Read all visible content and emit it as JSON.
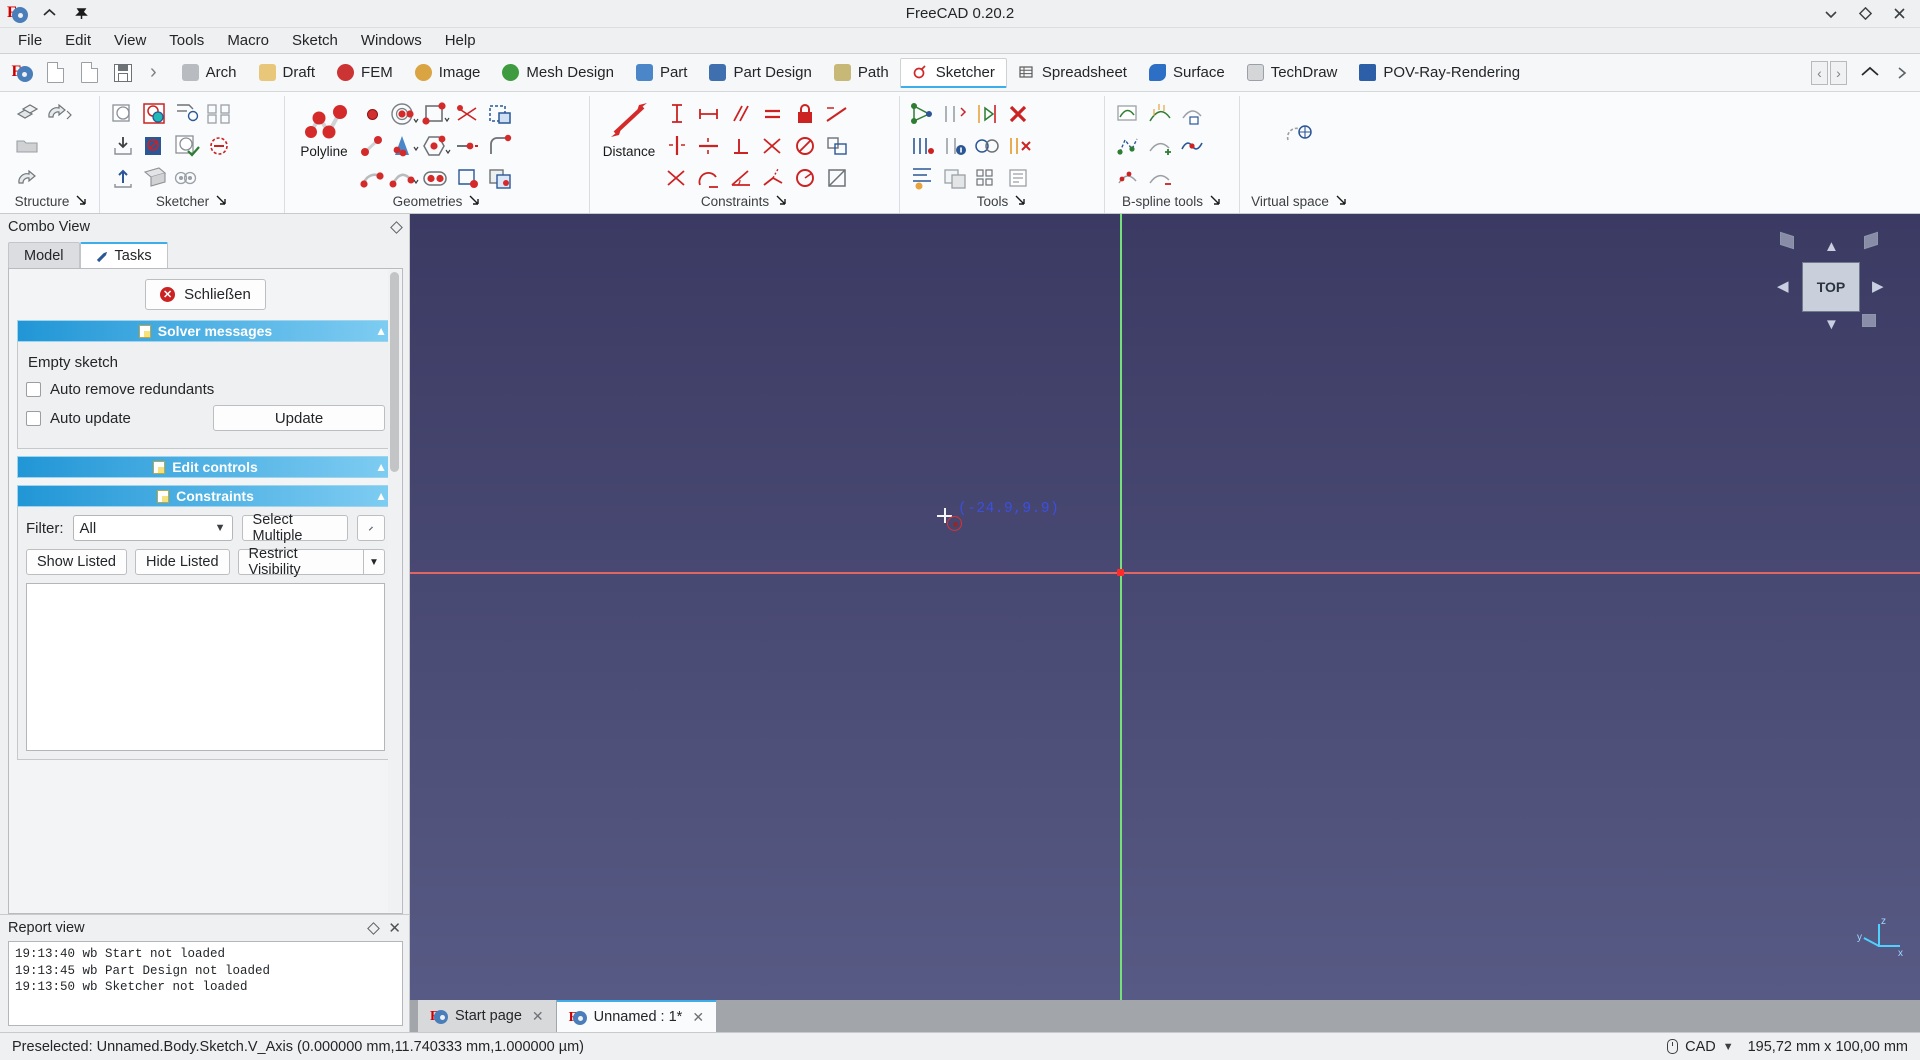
{
  "titlebar": {
    "title": "FreeCAD 0.20.2",
    "logo_icon": "freecad-logo-icon",
    "collapse_icon": "chevron-up-icon",
    "pin_icon": "pin-icon",
    "minimize_icon": "chevron-down-icon",
    "settings_icon": "diamond-icon",
    "close_icon": "close-icon"
  },
  "menubar": {
    "items": [
      {
        "label": "File"
      },
      {
        "label": "Edit"
      },
      {
        "label": "View"
      },
      {
        "label": "Tools"
      },
      {
        "label": "Macro"
      },
      {
        "label": "Sketch"
      },
      {
        "label": "Windows"
      },
      {
        "label": "Help"
      }
    ]
  },
  "workbench_tabs": {
    "quick_icons": [
      "freecad-logo-icon",
      "new-document-icon",
      "open-document-icon",
      "save-document-icon",
      "chevron-right-icon"
    ],
    "items": [
      {
        "label": "Arch",
        "icon": "arch-icon",
        "color": "#b8bcc0",
        "active": false
      },
      {
        "label": "Draft",
        "icon": "draft-icon",
        "color": "#e8c77a",
        "active": false
      },
      {
        "label": "FEM",
        "icon": "fem-icon",
        "color": "#cc3333",
        "active": false
      },
      {
        "label": "Image",
        "icon": "image-icon",
        "color": "#d9a441",
        "active": false
      },
      {
        "label": "Mesh Design",
        "icon": "mesh-design-icon",
        "color": "#3f9b3f",
        "active": false
      },
      {
        "label": "Part",
        "icon": "part-icon",
        "color": "#4a86c8",
        "active": false
      },
      {
        "label": "Part Design",
        "icon": "part-design-icon",
        "color": "#3f6fae",
        "active": false
      },
      {
        "label": "Path",
        "icon": "path-icon",
        "color": "#c8b878",
        "active": false
      },
      {
        "label": "Sketcher",
        "icon": "sketcher-icon",
        "color": "#d02828",
        "active": true
      },
      {
        "label": "Spreadsheet",
        "icon": "spreadsheet-icon",
        "color": "#5a5a5a",
        "active": false
      },
      {
        "label": "Surface",
        "icon": "surface-icon",
        "color": "#2d6fc4",
        "active": false
      },
      {
        "label": "TechDraw",
        "icon": "techdraw-icon",
        "color": "#9aa0a6",
        "active": false
      },
      {
        "label": "POV-Ray-Rendering",
        "icon": "povray-icon",
        "color": "#2d5fa8",
        "active": false
      }
    ],
    "scroll_left_icon": "chevron-left-icon",
    "scroll_right_icon": "chevron-right-icon",
    "collapse_ribbon_icon": "chevron-up-icon",
    "overflow_icon": "chevron-right-icon"
  },
  "ribbon": {
    "groups": [
      {
        "name": "Structure",
        "label": "Structure",
        "expand_icon": "expand-dialog-icon"
      },
      {
        "name": "Sketcher",
        "label": "Sketcher",
        "expand_icon": "expand-dialog-icon"
      },
      {
        "name": "Geometries",
        "label": "Geometries",
        "expand_icon": "expand-dialog-icon",
        "big_button": {
          "label": "Polyline",
          "icon": "polyline-icon"
        }
      },
      {
        "name": "Constraints",
        "label": "Constraints",
        "expand_icon": "expand-dialog-icon",
        "big_button": {
          "label": "Distance",
          "icon": "distance-icon"
        }
      },
      {
        "name": "Tools",
        "label": "Tools",
        "expand_icon": "expand-dialog-icon"
      },
      {
        "name": "B-spline tools",
        "label": "B-spline tools",
        "expand_icon": "expand-dialog-icon"
      },
      {
        "name": "Virtual space",
        "label": "Virtual space",
        "expand_icon": "expand-dialog-icon"
      }
    ]
  },
  "combo_view": {
    "title": "Combo View",
    "float_icon": "diamond-icon",
    "tabs": [
      {
        "label": "Model",
        "icon": "model-icon",
        "active": false
      },
      {
        "label": "Tasks",
        "icon": "pencil-icon",
        "active": true
      }
    ],
    "close_button": {
      "label": "Schließen",
      "icon": "close-circle-icon"
    },
    "solver": {
      "header": "Solver messages",
      "header_icon": "note-icon",
      "collapse_icon": "chevron-up-icon",
      "message": "Empty sketch",
      "auto_remove_redundants": {
        "label": "Auto remove redundants",
        "checked": false
      },
      "auto_update": {
        "label": "Auto update",
        "checked": false
      },
      "update_button": "Update"
    },
    "edit_controls": {
      "header": "Edit controls",
      "header_icon": "note-icon",
      "collapse_icon": "chevron-up-icon"
    },
    "constraints": {
      "header": "Constraints",
      "header_icon": "note-icon",
      "collapse_icon": "chevron-up-icon",
      "filter_label": "Filter:",
      "filter_value": "All",
      "filter_arrow_icon": "chevron-down-icon",
      "select_multiple_button": "Select Multiple",
      "settings_icon": "settings-wand-icon",
      "show_listed_button": "Show Listed",
      "hide_listed_button": "Hide Listed",
      "restrict_visibility_button": "Restrict Visibility",
      "restrict_arrow_icon": "chevron-down-icon",
      "list_items": []
    }
  },
  "report_view": {
    "title": "Report view",
    "float_icon": "diamond-icon",
    "close_icon": "close-icon",
    "lines": [
      "19:13:40   wb Start not loaded",
      "19:13:45   wb Part Design not loaded",
      "19:13:50   wb Sketcher not loaded"
    ]
  },
  "viewport": {
    "coordinate_label": "(-24.9,9.9)",
    "coordinate_color": "#3b4fe0",
    "cursor_icon": "crosshair-cursor-icon",
    "point_marker_icon": "sketch-point-icon",
    "vertical_axis_color": "#77e07a",
    "horizontal_axis_color": "#e06666",
    "origin_color": "#ff2a2a",
    "background_top": "#3b3a63",
    "background_bottom": "#575a84",
    "navcube": {
      "face_label": "TOP",
      "up_arrow_icon": "nav-arrow-up-icon",
      "down_arrow_icon": "nav-arrow-down-icon",
      "left_arrow_icon": "nav-arrow-left-icon",
      "right_arrow_icon": "nav-arrow-right-icon"
    },
    "axis_gizmo": {
      "x_label": "x",
      "y_label": "y",
      "z_label": "z"
    }
  },
  "document_tabs": [
    {
      "label": "Start page",
      "icon": "freecad-logo-icon",
      "close_icon": "close-icon",
      "active": false
    },
    {
      "label": "Unnamed : 1*",
      "icon": "freecad-logo-icon",
      "close_icon": "close-icon",
      "active": true
    }
  ],
  "statusbar": {
    "message": "Preselected: Unnamed.Body.Sketch.V_Axis (0.000000 mm,11.740333 mm,1.000000 µm)",
    "unit_icon": "mouse-icon",
    "unit_label": "CAD",
    "unit_arrow_icon": "chevron-down-icon",
    "dimensions": "195,72 mm x 100,00 mm"
  }
}
